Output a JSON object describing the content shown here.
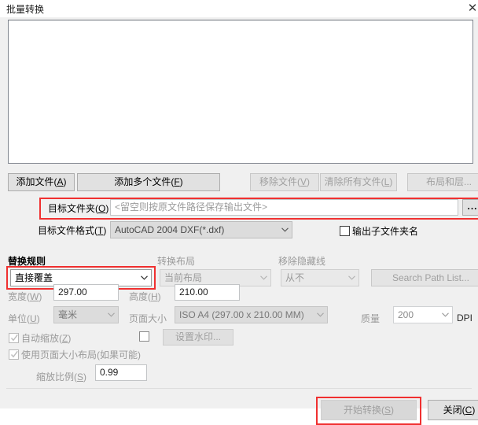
{
  "window": {
    "title": "批量转换",
    "close_icon": "close-icon",
    "close_glyph": "✕"
  },
  "file_list": {
    "items": [],
    "empty": true
  },
  "toolbar": {
    "add_file": "添加文件(A)",
    "add_file_mnemonic": "A",
    "add_multiple_files": "添加多个文件(F)",
    "add_multiple_mnemonic": "F",
    "remove_file": "移除文件(V)",
    "remove_file_mnemonic": "V",
    "clear_all_files": "清除所有文件(L)",
    "clear_all_mnemonic": "L",
    "layout_and_layers": "布局和层..."
  },
  "target_folder": {
    "label": "目标文件夹(O)",
    "label_mnemonic": "O",
    "value": "",
    "placeholder": "<留空则按原文件路径保存输出文件>",
    "browse_button": "...",
    "highlighted": true
  },
  "target_format": {
    "label": "目标文件格式(T)",
    "label_mnemonic": "T",
    "value": "AutoCAD 2004 DXF(*.dxf)",
    "options": [
      "AutoCAD 2004 DXF(*.dxf)"
    ]
  },
  "output_subfolder": {
    "label": "输出子文件夹名",
    "checked": false
  },
  "replace_rule": {
    "label": "替换规则",
    "value": "直接覆盖",
    "options": [
      "直接覆盖"
    ],
    "highlighted": true
  },
  "convert_layout": {
    "label": "转换布局",
    "value": "当前布局",
    "options": [
      "当前布局"
    ],
    "disabled": true
  },
  "remove_hidden_lines": {
    "label": "移除隐藏线",
    "value": "从不",
    "options": [
      "从不"
    ],
    "disabled": true
  },
  "search_path": {
    "label": "Search Path List...",
    "disabled": true
  },
  "dimensions": {
    "width_label": "宽度(W)",
    "width_mnemonic": "W",
    "width_value": "297.00",
    "height_label": "高度(H)",
    "height_mnemonic": "H",
    "height_value": "210.00",
    "unit_label": "单位(U)",
    "unit_mnemonic": "U",
    "unit_value": "毫米",
    "unit_options": [
      "毫米"
    ],
    "page_size_label": "页面大小",
    "page_size_value": "ISO A4 (297.00 x 210.00 MM)",
    "page_size_options": [
      "ISO A4 (297.00 x 210.00 MM)"
    ],
    "quality_label": "质量",
    "quality_value": "200",
    "quality_options": [
      "200"
    ],
    "quality_unit": "DPI"
  },
  "options": {
    "auto_scale_label": "自动缩放(Z)",
    "auto_scale_mnemonic": "Z",
    "auto_scale_checked": true,
    "auto_scale_disabled": true,
    "watermark_checked": false,
    "watermark_button": "设置水印...",
    "watermark_disabled": true,
    "use_page_layout_label": "使用页面大小布局(如果可能)",
    "use_page_layout_checked": true,
    "use_page_layout_disabled": true,
    "scale_ratio_label": "缩放比例(S)",
    "scale_ratio_mnemonic": "S",
    "scale_ratio_value": "0.99"
  },
  "footer": {
    "start_convert": "开始转换(S)",
    "start_convert_mnemonic": "S",
    "start_convert_disabled": true,
    "start_convert_highlighted": true,
    "close": "关闭(C)",
    "close_mnemonic": "C"
  },
  "colors": {
    "highlight": "#f03030",
    "dialog_bg": "#f0f0f0",
    "button_bg": "#e1e1e1",
    "disabled_text": "#a0a0a0"
  }
}
